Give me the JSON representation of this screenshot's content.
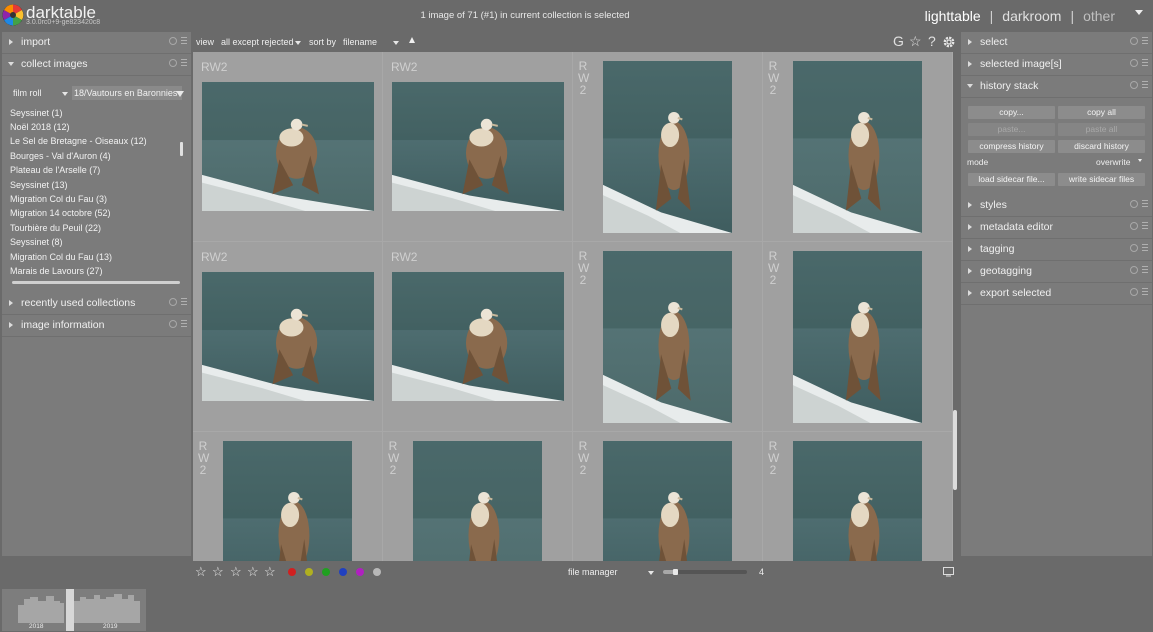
{
  "header": {
    "app_name": "darktable",
    "app_version": "3.0.0rc0+9-ge823420c8",
    "status": "1 image of 71 (#1) in current collection is selected",
    "views": [
      "lighttable",
      "darkroom",
      "other"
    ],
    "separator": "|"
  },
  "left_panel": {
    "modules": {
      "import": "import",
      "collect": "collect images",
      "recent": "recently used collections",
      "info": "image information"
    },
    "collect": {
      "property": "film roll",
      "rule_value": "18/Vautours en Baronnies",
      "items": [
        "Seyssinet (1)",
        "Noël 2018 (12)",
        "Le Sel de Bretagne - Oiseaux (12)",
        "Bourges - Val d'Auron (4)",
        "Plateau de l'Arselle (7)",
        "Seyssinet (13)",
        "Migration Col du Fau (3)",
        "Migration 14 octobre (52)",
        "Tourbière du Peuil (22)",
        "Seyssinet (8)",
        "Migration Col du Fau (13)",
        "Marais de Lavours (27)"
      ]
    }
  },
  "center": {
    "view_label": "view",
    "view_value": "all except rejected",
    "sort_label": "sort by",
    "sort_value": "filename",
    "grid_ext": "RW2",
    "layout": "file manager",
    "zoom": "4"
  },
  "right_panel": {
    "modules": {
      "select": "select",
      "selected": "selected image[s]",
      "history": "history stack",
      "styles": "styles",
      "metadata": "metadata editor",
      "tagging": "tagging",
      "geotagging": "geotagging",
      "export": "export selected"
    },
    "history": {
      "copy": "copy...",
      "copy_all": "copy all",
      "paste": "paste...",
      "paste_all": "paste all",
      "compress": "compress history",
      "discard": "discard history",
      "mode_label": "mode",
      "mode_value": "overwrite",
      "load_sidecar": "load sidecar file...",
      "write_sidecar": "write sidecar files"
    }
  },
  "timeline": {
    "years": [
      "2018",
      "2019"
    ]
  },
  "colors": {
    "labels": [
      "#d02020",
      "#b0b020",
      "#20a020",
      "#2040c0",
      "#b020c0",
      "#b8b8b8"
    ]
  }
}
